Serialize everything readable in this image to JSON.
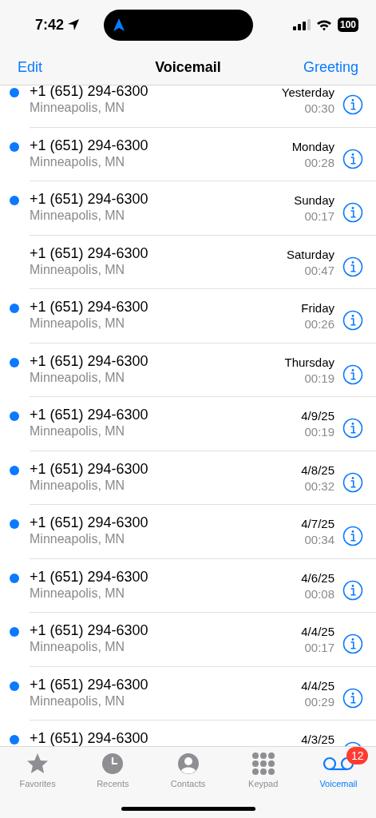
{
  "status_bar": {
    "time": "7:42",
    "battery": "100"
  },
  "nav": {
    "left": "Edit",
    "title": "Voicemail",
    "right": "Greeting"
  },
  "voicemails": [
    {
      "number": "+1 (651) 294-6300",
      "location": "Minneapolis, MN",
      "date": "Yesterday",
      "duration": "00:30",
      "unread": true
    },
    {
      "number": "+1 (651) 294-6300",
      "location": "Minneapolis, MN",
      "date": "Monday",
      "duration": "00:28",
      "unread": true
    },
    {
      "number": "+1 (651) 294-6300",
      "location": "Minneapolis, MN",
      "date": "Sunday",
      "duration": "00:17",
      "unread": true
    },
    {
      "number": "+1 (651) 294-6300",
      "location": "Minneapolis, MN",
      "date": "Saturday",
      "duration": "00:47",
      "unread": false
    },
    {
      "number": "+1 (651) 294-6300",
      "location": "Minneapolis, MN",
      "date": "Friday",
      "duration": "00:26",
      "unread": true
    },
    {
      "number": "+1 (651) 294-6300",
      "location": "Minneapolis, MN",
      "date": "Thursday",
      "duration": "00:19",
      "unread": true
    },
    {
      "number": "+1 (651) 294-6300",
      "location": "Minneapolis, MN",
      "date": "4/9/25",
      "duration": "00:19",
      "unread": true
    },
    {
      "number": "+1 (651) 294-6300",
      "location": "Minneapolis, MN",
      "date": "4/8/25",
      "duration": "00:32",
      "unread": true
    },
    {
      "number": "+1 (651) 294-6300",
      "location": "Minneapolis, MN",
      "date": "4/7/25",
      "duration": "00:34",
      "unread": true
    },
    {
      "number": "+1 (651) 294-6300",
      "location": "Minneapolis, MN",
      "date": "4/6/25",
      "duration": "00:08",
      "unread": true
    },
    {
      "number": "+1 (651) 294-6300",
      "location": "Minneapolis, MN",
      "date": "4/4/25",
      "duration": "00:17",
      "unread": true
    },
    {
      "number": "+1 (651) 294-6300",
      "location": "Minneapolis, MN",
      "date": "4/4/25",
      "duration": "00:29",
      "unread": true
    },
    {
      "number": "+1 (651) 294-6300",
      "date": "4/3/25",
      "unread": true
    }
  ],
  "tabs": [
    {
      "kind": "favorites",
      "label": "Favorites",
      "selected": false
    },
    {
      "kind": "recents",
      "label": "Recents",
      "selected": false
    },
    {
      "kind": "contacts",
      "label": "Contacts",
      "selected": false
    },
    {
      "kind": "keypad",
      "label": "Keypad",
      "selected": false
    },
    {
      "kind": "voicemail",
      "label": "Voicemail",
      "selected": true,
      "badge": "12"
    }
  ]
}
